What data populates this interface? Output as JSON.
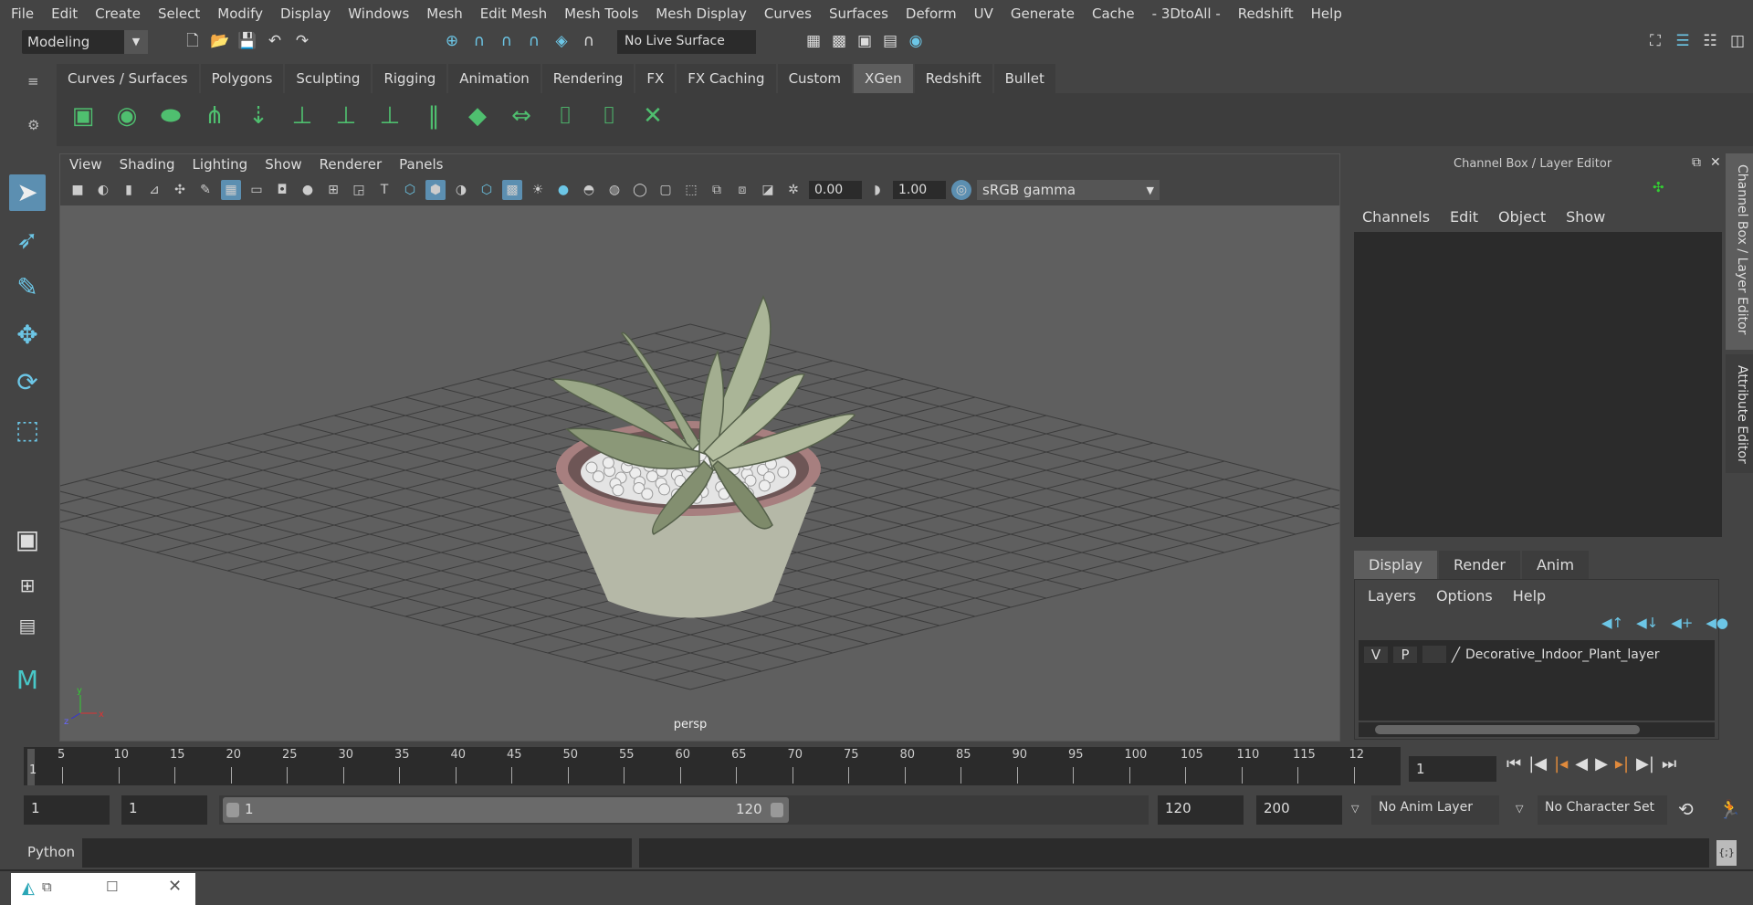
{
  "menu": [
    "File",
    "Edit",
    "Create",
    "Select",
    "Modify",
    "Display",
    "Windows",
    "Mesh",
    "Edit Mesh",
    "Mesh Tools",
    "Mesh Display",
    "Curves",
    "Surfaces",
    "Deform",
    "UV",
    "Generate",
    "Cache",
    "- 3DtoAll -",
    "Redshift",
    "Help"
  ],
  "status": {
    "mode": "Modeling",
    "live_surface": "No Live Surface"
  },
  "shelf_tabs": [
    "Curves / Surfaces",
    "Polygons",
    "Sculpting",
    "Rigging",
    "Animation",
    "Rendering",
    "FX",
    "FX Caching",
    "Custom",
    "XGen",
    "Redshift",
    "Bullet"
  ],
  "active_shelf": "XGen",
  "viewport": {
    "menu": [
      "View",
      "Shading",
      "Lighting",
      "Show",
      "Renderer",
      "Panels"
    ],
    "exposure": "0.00",
    "gamma": "1.00",
    "color_space": "sRGB gamma",
    "camera": "persp",
    "axis": {
      "x": "x",
      "y": "y",
      "z": "z"
    }
  },
  "channel_box": {
    "title": "Channel Box / Layer Editor",
    "menu": [
      "Channels",
      "Edit",
      "Object",
      "Show"
    ]
  },
  "layer_editor": {
    "tabs": [
      "Display",
      "Render",
      "Anim"
    ],
    "menu": [
      "Layers",
      "Options",
      "Help"
    ],
    "layer": {
      "v": "V",
      "p": "P",
      "name": "Decorative_Indoor_Plant_layer"
    }
  },
  "side_tabs": [
    "Channel Box / Layer Editor",
    "Attribute Editor"
  ],
  "timeline": {
    "ticks": [
      "5",
      "10",
      "15",
      "20",
      "25",
      "30",
      "35",
      "40",
      "45",
      "50",
      "55",
      "60",
      "65",
      "70",
      "75",
      "80",
      "85",
      "90",
      "95",
      "100",
      "105",
      "110",
      "115",
      "12"
    ],
    "current_marker": "1",
    "current_frame": "1"
  },
  "range": {
    "start": "1",
    "start2": "1",
    "slider_start": "1",
    "slider_end": "120",
    "end": "120",
    "end2": "200",
    "anim_layer": "No Anim Layer",
    "char_set": "No Character Set"
  },
  "cmd": {
    "lang": "Python"
  }
}
